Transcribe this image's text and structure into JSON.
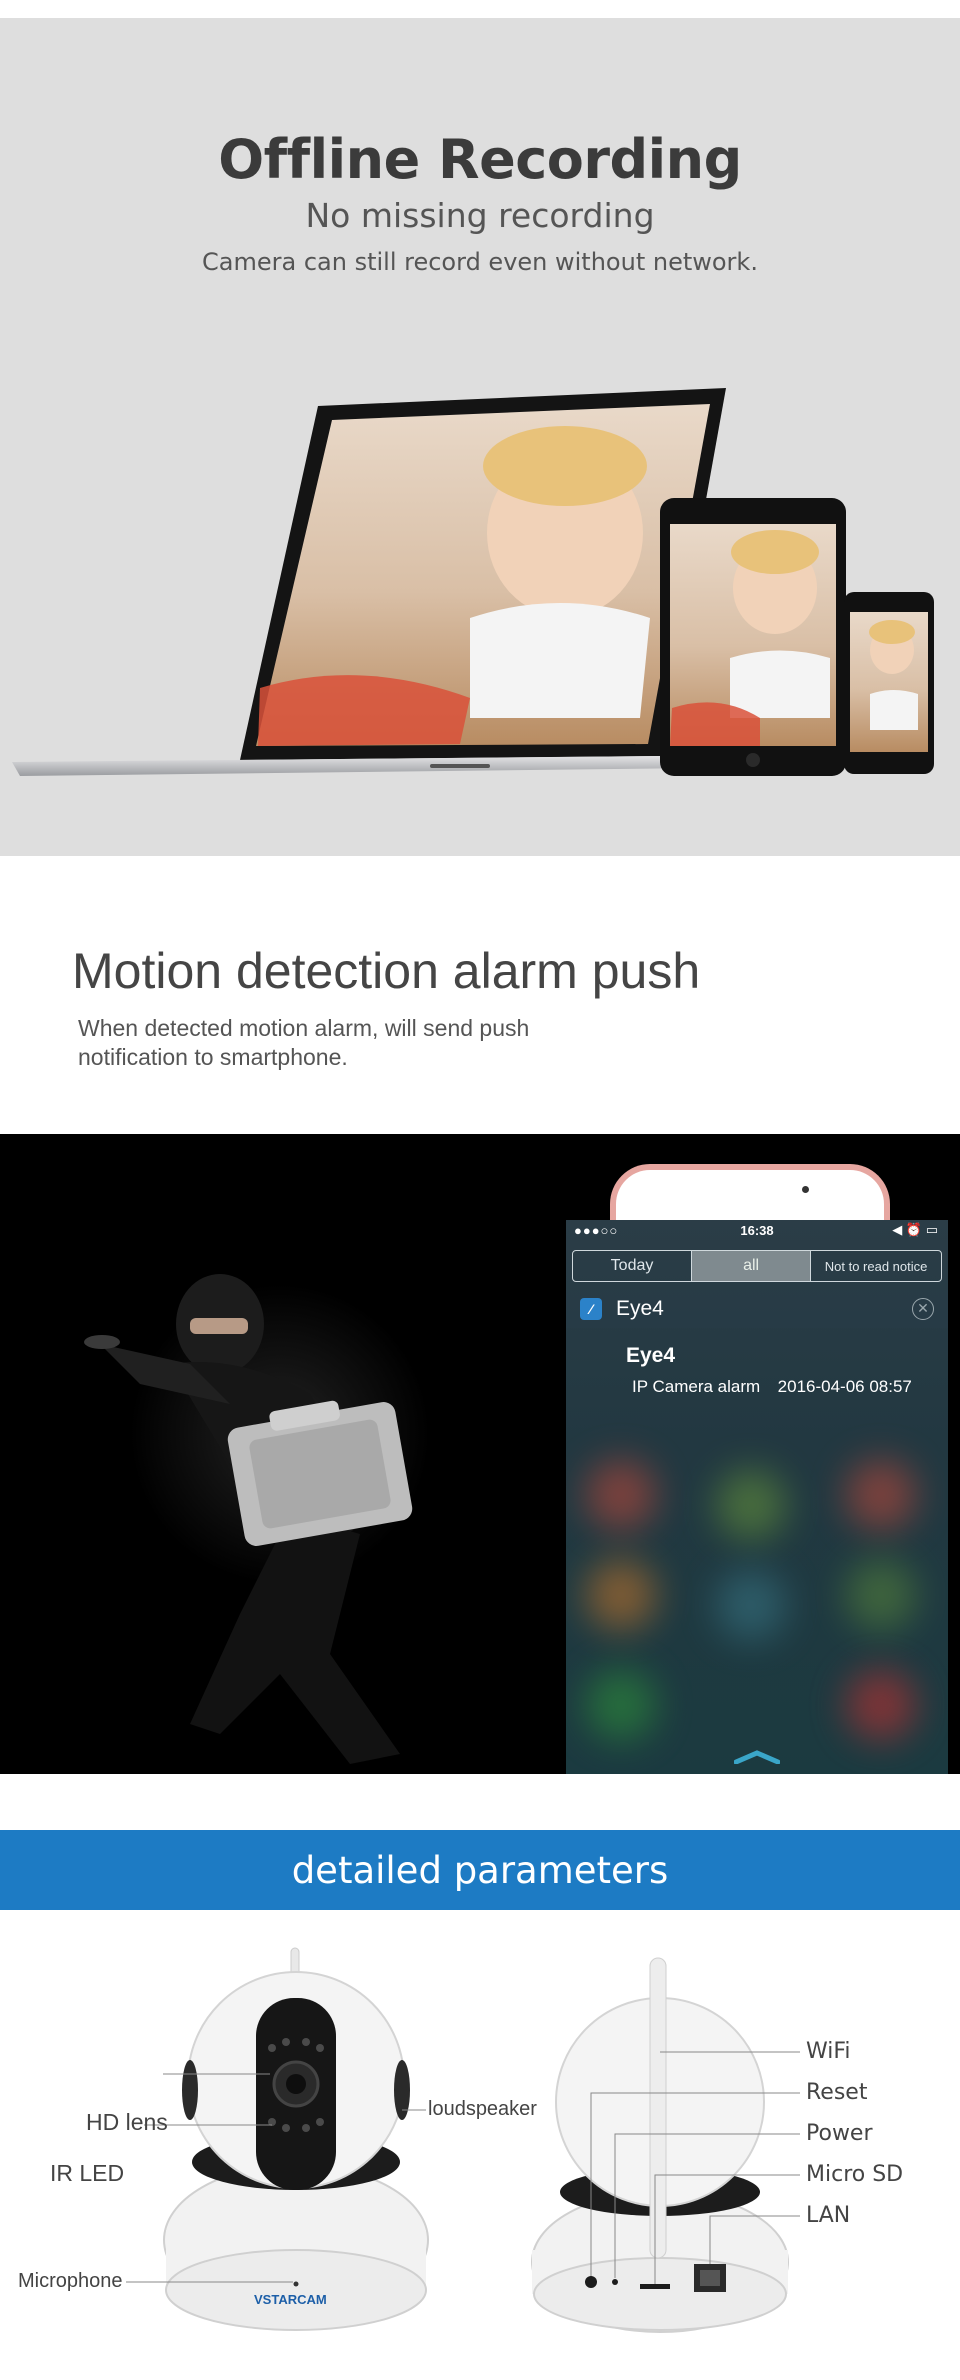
{
  "offline": {
    "title": "Offline Recording",
    "subtitle": "No missing recording",
    "description": "Camera can still record even without network."
  },
  "motion": {
    "title": "Motion detection alarm push",
    "description_line1": "When detected motion alarm, will send push",
    "description_line2": "notification to smartphone.",
    "phone": {
      "time": "16:38",
      "signal": "●●●○○",
      "tabs": [
        "Today",
        "all",
        "Not to read notice"
      ],
      "app_name": "Eye4",
      "notification_title": "Eye4",
      "notification_body": "IP Camera alarm",
      "notification_date": "2016-04-06  08:57"
    }
  },
  "parameters": {
    "heading": "detailed parameters",
    "front_labels": {
      "hd_lens": "HD lens",
      "ir_led": "IR LED",
      "microphone": "Microphone",
      "loudspeaker": "loudspeaker",
      "brand": "VSTARCAM"
    },
    "back_labels": {
      "wifi": "WiFi",
      "reset": "Reset",
      "power": "Power",
      "micro_sd": "Micro SD",
      "lan": "LAN"
    }
  },
  "colors": {
    "section_gray": "#dedede",
    "accent_blue": "#1d7bc4",
    "dark": "#000000"
  }
}
